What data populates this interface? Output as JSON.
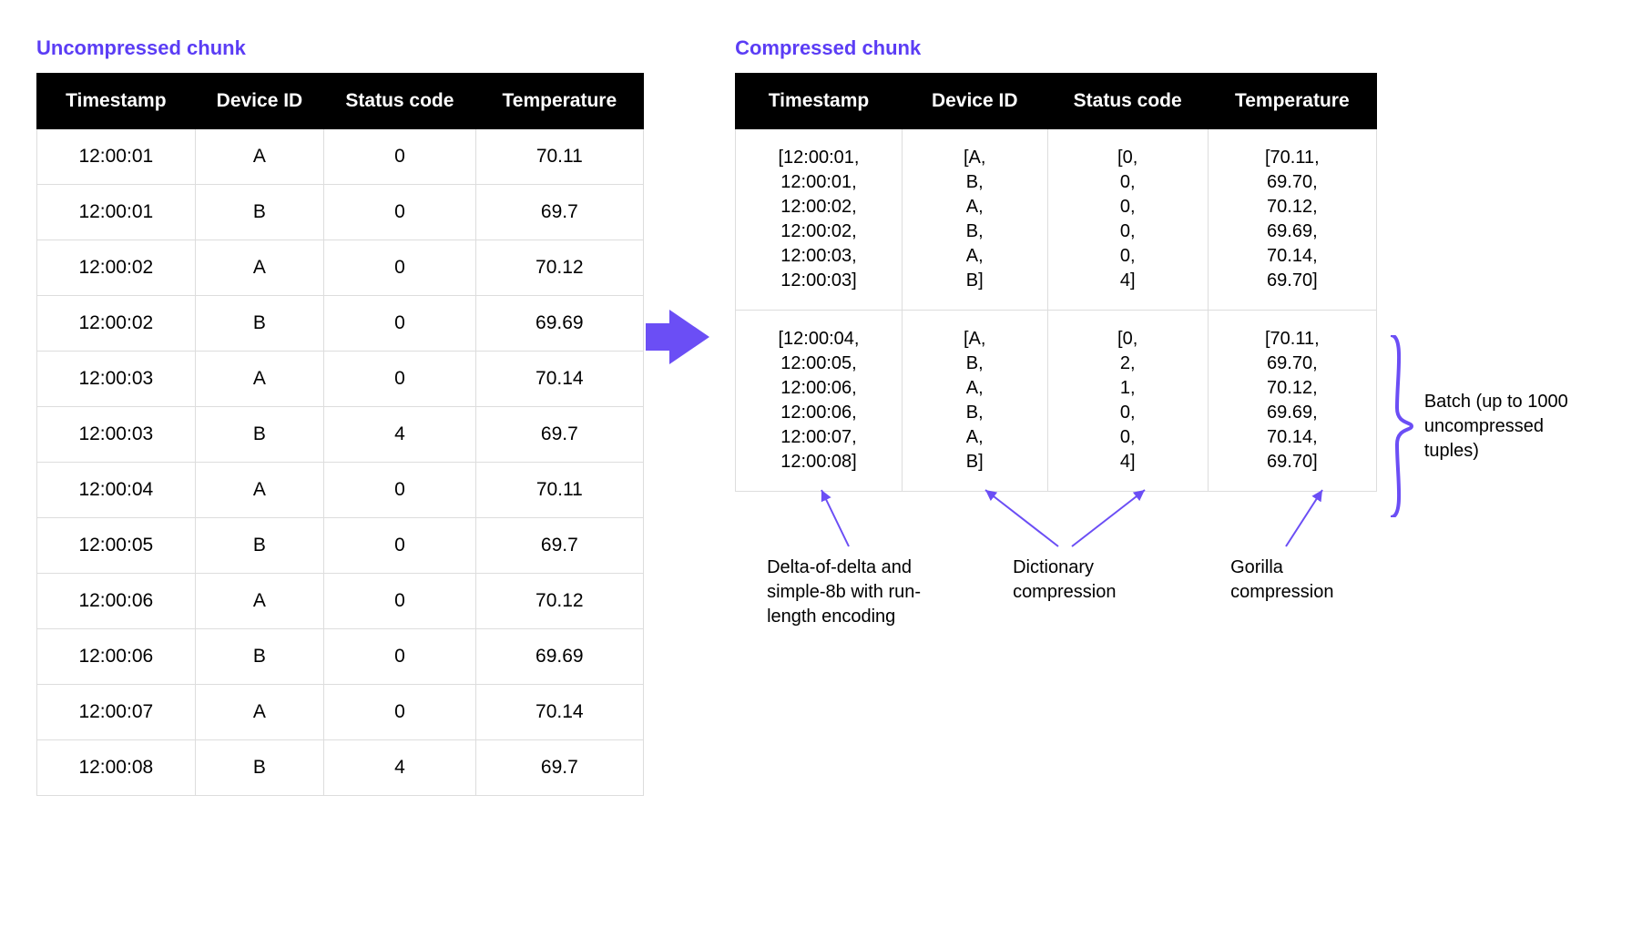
{
  "accent_color": "#6b4ef5",
  "left_title": "Uncompressed chunk",
  "right_title": "Compressed chunk",
  "columns": [
    "Timestamp",
    "Device ID",
    "Status code",
    "Temperature"
  ],
  "uncompressed_rows": [
    [
      "12:00:01",
      "A",
      "0",
      "70.11"
    ],
    [
      "12:00:01",
      "B",
      "0",
      "69.7"
    ],
    [
      "12:00:02",
      "A",
      "0",
      "70.12"
    ],
    [
      "12:00:02",
      "B",
      "0",
      "69.69"
    ],
    [
      "12:00:03",
      "A",
      "0",
      "70.14"
    ],
    [
      "12:00:03",
      "B",
      "4",
      "69.7"
    ],
    [
      "12:00:04",
      "A",
      "0",
      "70.11"
    ],
    [
      "12:00:05",
      "B",
      "0",
      "69.7"
    ],
    [
      "12:00:06",
      "A",
      "0",
      "70.12"
    ],
    [
      "12:00:06",
      "B",
      "0",
      "69.69"
    ],
    [
      "12:00:07",
      "A",
      "0",
      "70.14"
    ],
    [
      "12:00:08",
      "B",
      "4",
      "69.7"
    ]
  ],
  "compressed_rows": [
    {
      "timestamp": [
        "12:00:01",
        "12:00:01",
        "12:00:02",
        "12:00:02",
        "12:00:03",
        "12:00:03"
      ],
      "device_id": [
        "A",
        "B",
        "A",
        "B",
        "A",
        "B"
      ],
      "status_code": [
        "0",
        "0",
        "0",
        "0",
        "0",
        "4"
      ],
      "temperature": [
        "70.11",
        "69.70",
        "70.12",
        "69.69",
        "70.14",
        "69.70"
      ]
    },
    {
      "timestamp": [
        "12:00:04",
        "12:00:05",
        "12:00:06",
        "12:00:06",
        "12:00:07",
        "12:00:08"
      ],
      "device_id": [
        "A",
        "B",
        "A",
        "B",
        "A",
        "B"
      ],
      "status_code": [
        "0",
        "2",
        "1",
        "0",
        "0",
        "4"
      ],
      "temperature": [
        "70.11",
        "69.70",
        "70.12",
        "69.69",
        "70.14",
        "69.70"
      ]
    }
  ],
  "brace_label": "Batch (up to 1000 uncompressed tuples)",
  "captions": {
    "timestamp": "Delta-of-delta and simple-8b with run-length encoding",
    "device_status": "Dictionary compression",
    "temperature": "Gorilla compression"
  }
}
